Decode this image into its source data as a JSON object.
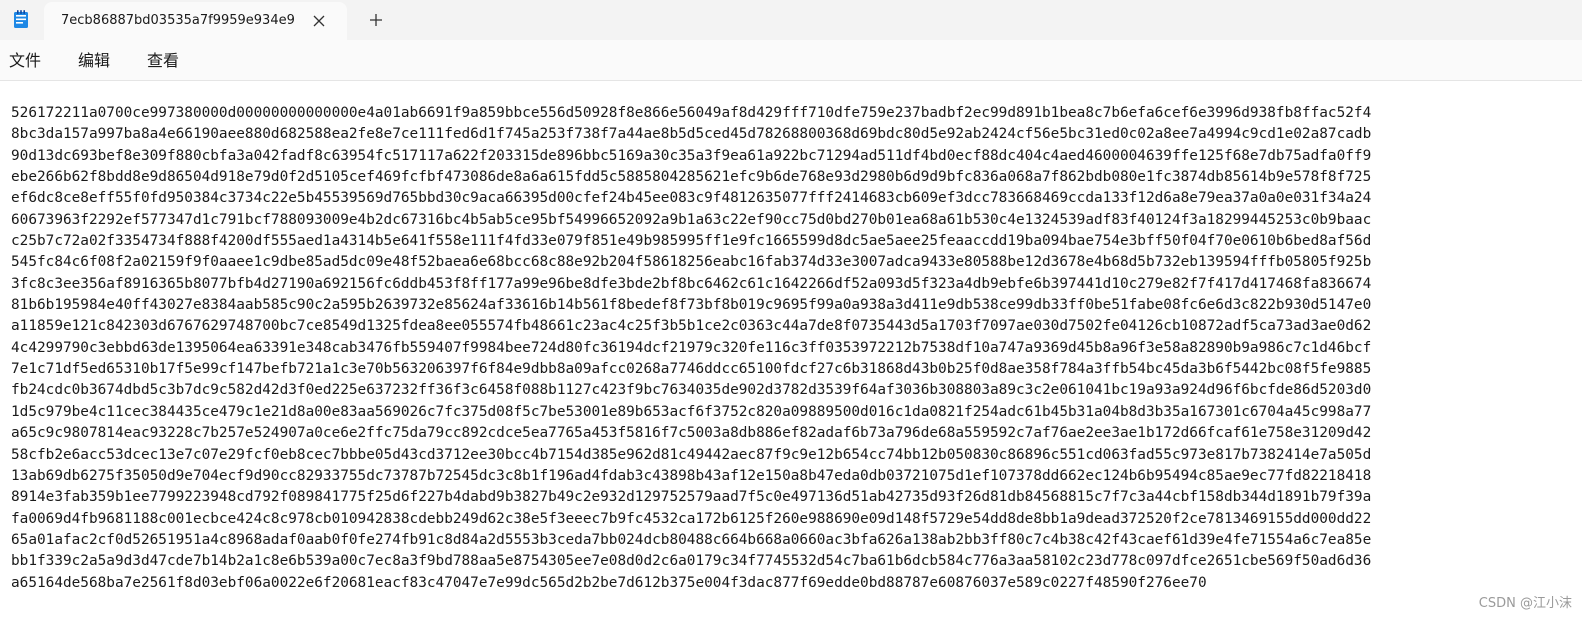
{
  "app": {
    "icon": "notepad-icon",
    "tab_title": "7ecb86887bd03535a7f9959e934e9",
    "tab_close_icon": "close-icon",
    "new_tab_icon": "plus-icon"
  },
  "menu": {
    "file": "文件",
    "edit": "编辑",
    "view": "查看"
  },
  "editor": {
    "lines": [
      "526172211a0700ce997380000d00000000000000e4a01ab6691f9a859bbce556d50928f8e866e56049af8d429fff710dfe759e237badbf2ec99d891b1bea8c7b6efa6cef6e3996d938fb8ffac52f4",
      "8bc3da157a997ba8a4e66190aee880d682588ea2fe8e7ce111fed6d1f745a253f738f7a44ae8b5d5ced45d78268800368d69bdc80d5e92ab2424cf56e5bc31ed0c02a8ee7a4994c9cd1e02a87cadb",
      "90d13dc693bef8e309f880cbfa3a042fadf8c63954fc517117a622f203315de896bbc5169a30c35a3f9ea61a922bc71294ad511df4bd0ecf88dc404c4aed4600004639ffe125f68e7db75adfa0ff9",
      "ebe266b62f8bdd8e9d86504d918e79d0f2d5105cef469fcfbf473086de8a6a615fdd5c5885804285621efc9b6de768e93d2980b6d9d9bfc836a068a7f862bdb080e1fc3874db85614b9e578f8f725",
      "ef6dc8ce8eff55f0fd950384c3734c22e5b45539569d765bbd30c9aca66395d00cfef24b45ee083c9f4812635077fff2414683cb609ef3dcc783668469ccda133f12d6a8e79ea37a0a0e031f34a24",
      "60673963f2292ef577347d1c791bcf788093009e4b2dc67316bc4b5ab5ce95bf54996652092a9b1a63c22ef90cc75d0bd270b01ea68a61b530c4e1324539adf83f40124f3a18299445253c0b9baac",
      "c25b7c72a02f3354734f888f4200df555aed1a4314b5e641f558e111f4fd33e079f851e49b985995ff1e9fc1665599d8dc5ae5aee25feaaccdd19ba094bae754e3bff50f04f70e0610b6bed8af56d",
      "545fc84c6f08f2a02159f9f0aaee1c9dbe85ad5dc09e48f52baea6e68bcc68c88e92b204f58618256eabc16fab374d33e3007adca9433e80588be12d3678e4b68d5b732eb139594fffb05805f925b",
      "3fc8c3ee356af8916365b8077bfb4d27190a692156fc6ddb453f8ff177a99e96be8dfe3bde2bf8bc6462c61c1642266df52a093d5f323a4db9ebfe6b397441d10c279e82f7f417d417468fa836674",
      "81b6b195984e40ff43027e8384aab585c90c2a595b2639732e85624af33616b14b561f8bedef8f73bf8b019c9695f99a0a938a3d411e9db538ce99db33ff0be51fabe08fc6e6d3c822b930d5147e0",
      "a11859e121c842303d6767629748700bc7ce8549d1325fdea8ee055574fb48661c23ac4c25f3b5b1ce2c0363c44a7de8f0735443d5a1703f7097ae030d7502fe04126cb10872adf5ca73ad3ae0d62",
      "4c4299790c3ebbd63de1395064ea63391e348cab3476fb559407f9984bee724d80fc36194dcf21979c320fe116c3ff0353972212b7538df10a747a9369d45b8a96f3e58a82890b9a986c7c1d46bcf",
      "7e1c71df5ed65310b17f5e99cf147befb721a1c3e70b563206397f6f84e9dbb8a09afcc0268a7746ddcc65100fdcf27c6b31868d43b0b25f0d8ae358f784a3ffb54bc45da3b6f5442bc08f5fe9885",
      "fb24cdc0b3674dbd5c3b7dc9c582d42d3f0ed225e637232ff36f3c6458f088b1127c423f9bc7634035de902d3782d3539f64af3036b308803a89c3c2e061041bc19a93a924d96f6bcfde86d5203d0",
      "1d5c979be4c11cec384435ce479c1e21d8a00e83aa569026c7fc375d08f5c7be53001e89b653acf6f3752c820a09889500d016c1da0821f254adc61b45b31a04b8d3b35a167301c6704a45c998a77",
      "a65c9c9807814eac93228c7b257e524907a0ce6e2ffc75da79cc892cdce5ea7765a453f5816f7c5003a8db886ef82adaf6b73a796de68a559592c7af76ae2ee3ae1b172d66fcaf61e758e31209d42",
      "58cfb2e6acc53dcec13e7c07e29fcf0eb8cec7bbbe05d43cd3712ee30bcc4b7154d385e962d81c49442aec87f9c9e12b654cc74bb12b050830c86896c551cd063fad55c973e817b7382414e7a505d",
      "13ab69db6275f35050d9e704ecf9d90cc82933755dc73787b72545dc3c8b1f196ad4fdab3c43898b43af12e150a8b47eda0db03721075d1ef107378dd662ec124b6b95494c85ae9ec77fd82218418",
      "8914e3fab359b1ee7799223948cd792f089841775f25d6f227b4dabd9b3827b49c2e932d129752579aad7f5c0e497136d51ab42735d93f26d81db84568815c7f7c3a44cbf158db344d1891b79f39a",
      "fa0069d4fb9681188c001ecbce424c8c978cb010942838cdebb249d62c38e5f3eeec7b9fc4532ca172b6125f260e988690e09d148f5729e54dd8de8bb1a9dead372520f2ce7813469155dd000dd22",
      "65a01afac2cf0d52651951a4c8968adaf0aab0f0fe274fb91c8d84a2d5553b3ceda7bb024dcb80488c664b668a0660ac3bfa626a138ab2bb3ff80c7c4b38c42f43caef61d39e4fe71554a6c7ea85e",
      "bb1f339c2a5a9d3d47cde7b14b2a1c8e6b539a00c7ec8a3f9bd788aa5e8754305ee7e08d0d2c6a0179c34f7745532d54c7ba61b6dcb584c776a3aa58102c23d778c097dfce2651cbe569f50ad6d36",
      "a65164de568ba7e2561f8d03ebf06a0022e6f20681eacf83c47047e7e99dc565d2b2be7d612b375e004f3dac877f69edde0bd88787e60876037e589c0227f48590f276ee70"
    ]
  },
  "watermark": "CSDN @江小沫"
}
